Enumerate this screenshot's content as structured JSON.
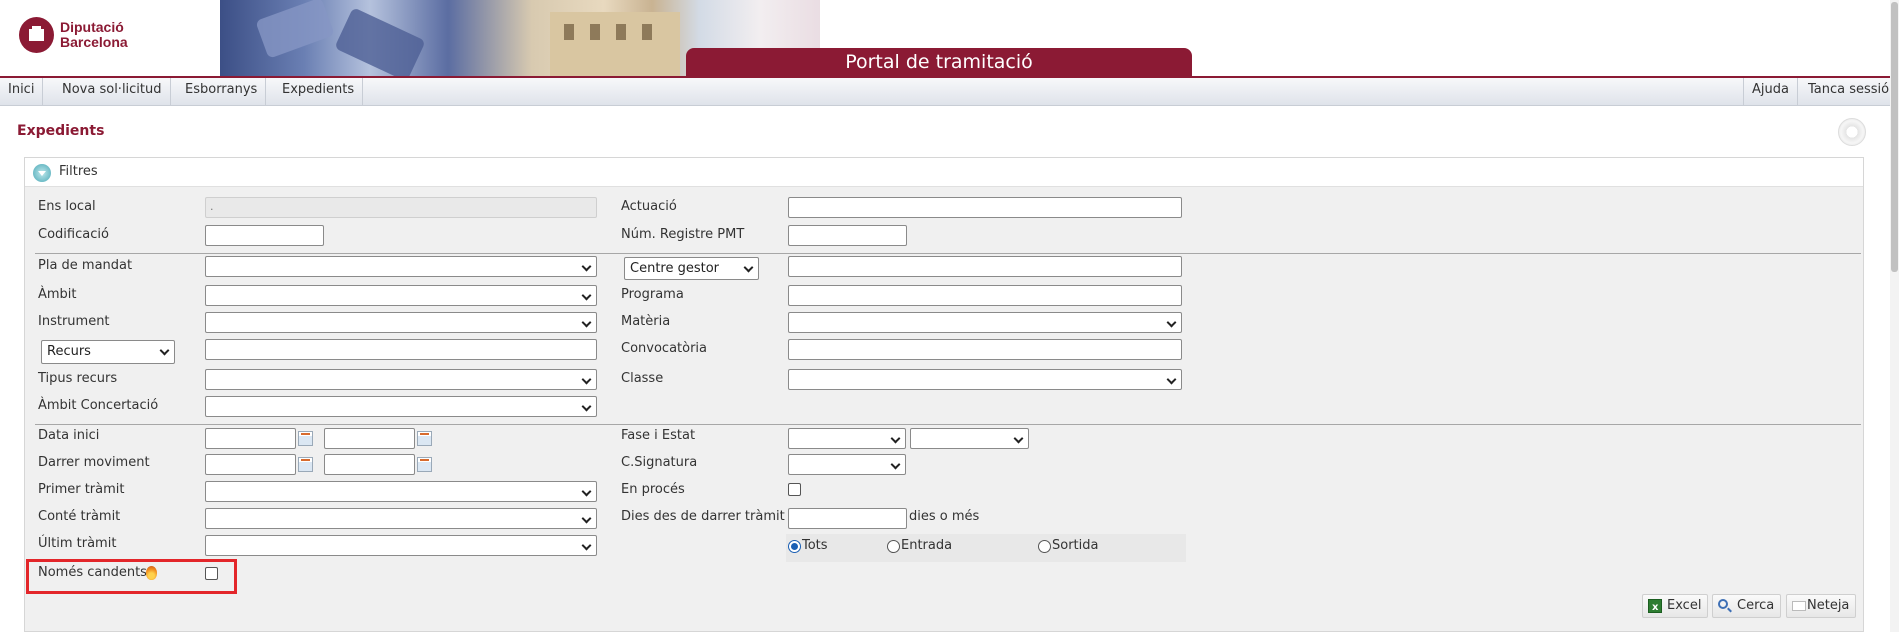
{
  "header": {
    "logo_line1": "Diputació",
    "logo_line2": "Barcelona",
    "portal_title": "Portal de tramitació"
  },
  "menu": {
    "left": [
      "Inici",
      "Nova sol·licitud",
      "Esborranys",
      "Expedients"
    ],
    "right": [
      "Ajuda",
      "Tanca sessió"
    ]
  },
  "page": {
    "title": "Expedients"
  },
  "filters": {
    "title": "Filtres",
    "labels": {
      "ens_local": "Ens local",
      "codificacio": "Codificació",
      "pla_mandat": "Pla de mandat",
      "ambit": "Àmbit",
      "instrument": "Instrument",
      "tipus_recurs": "Tipus recurs",
      "ambit_concertacio": "Àmbit Concertació",
      "data_inici": "Data inici",
      "darrer_moviment": "Darrer moviment",
      "primer_tramit": "Primer tràmit",
      "conte_tramit": "Conté tràmit",
      "ultim_tramit": "Últim tràmit",
      "nomes_candents": "Només candents",
      "actuacio": "Actuació",
      "num_registre": "Núm. Registre PMT",
      "programa": "Programa",
      "materia": "Matèria",
      "convocatoria": "Convocatòria",
      "classe": "Classe",
      "fase_estat": "Fase i Estat",
      "c_signatura": "C.Signatura",
      "en_proces": "En procés",
      "dies_darrer": "Dies des de darrer tràmit",
      "dies_suffix": "dies o més"
    },
    "ens_local_value": ".",
    "recurs_select": "Recurs",
    "centre_gestor_select": "Centre gestor",
    "direction": {
      "options": [
        "Tots",
        "Entrada",
        "Sortida"
      ],
      "selected": "Tots"
    },
    "nomes_candents_checked": false,
    "en_proces_checked": false
  },
  "buttons": {
    "excel": "Excel",
    "cerca": "Cerca",
    "neteja": "Neteja"
  }
}
